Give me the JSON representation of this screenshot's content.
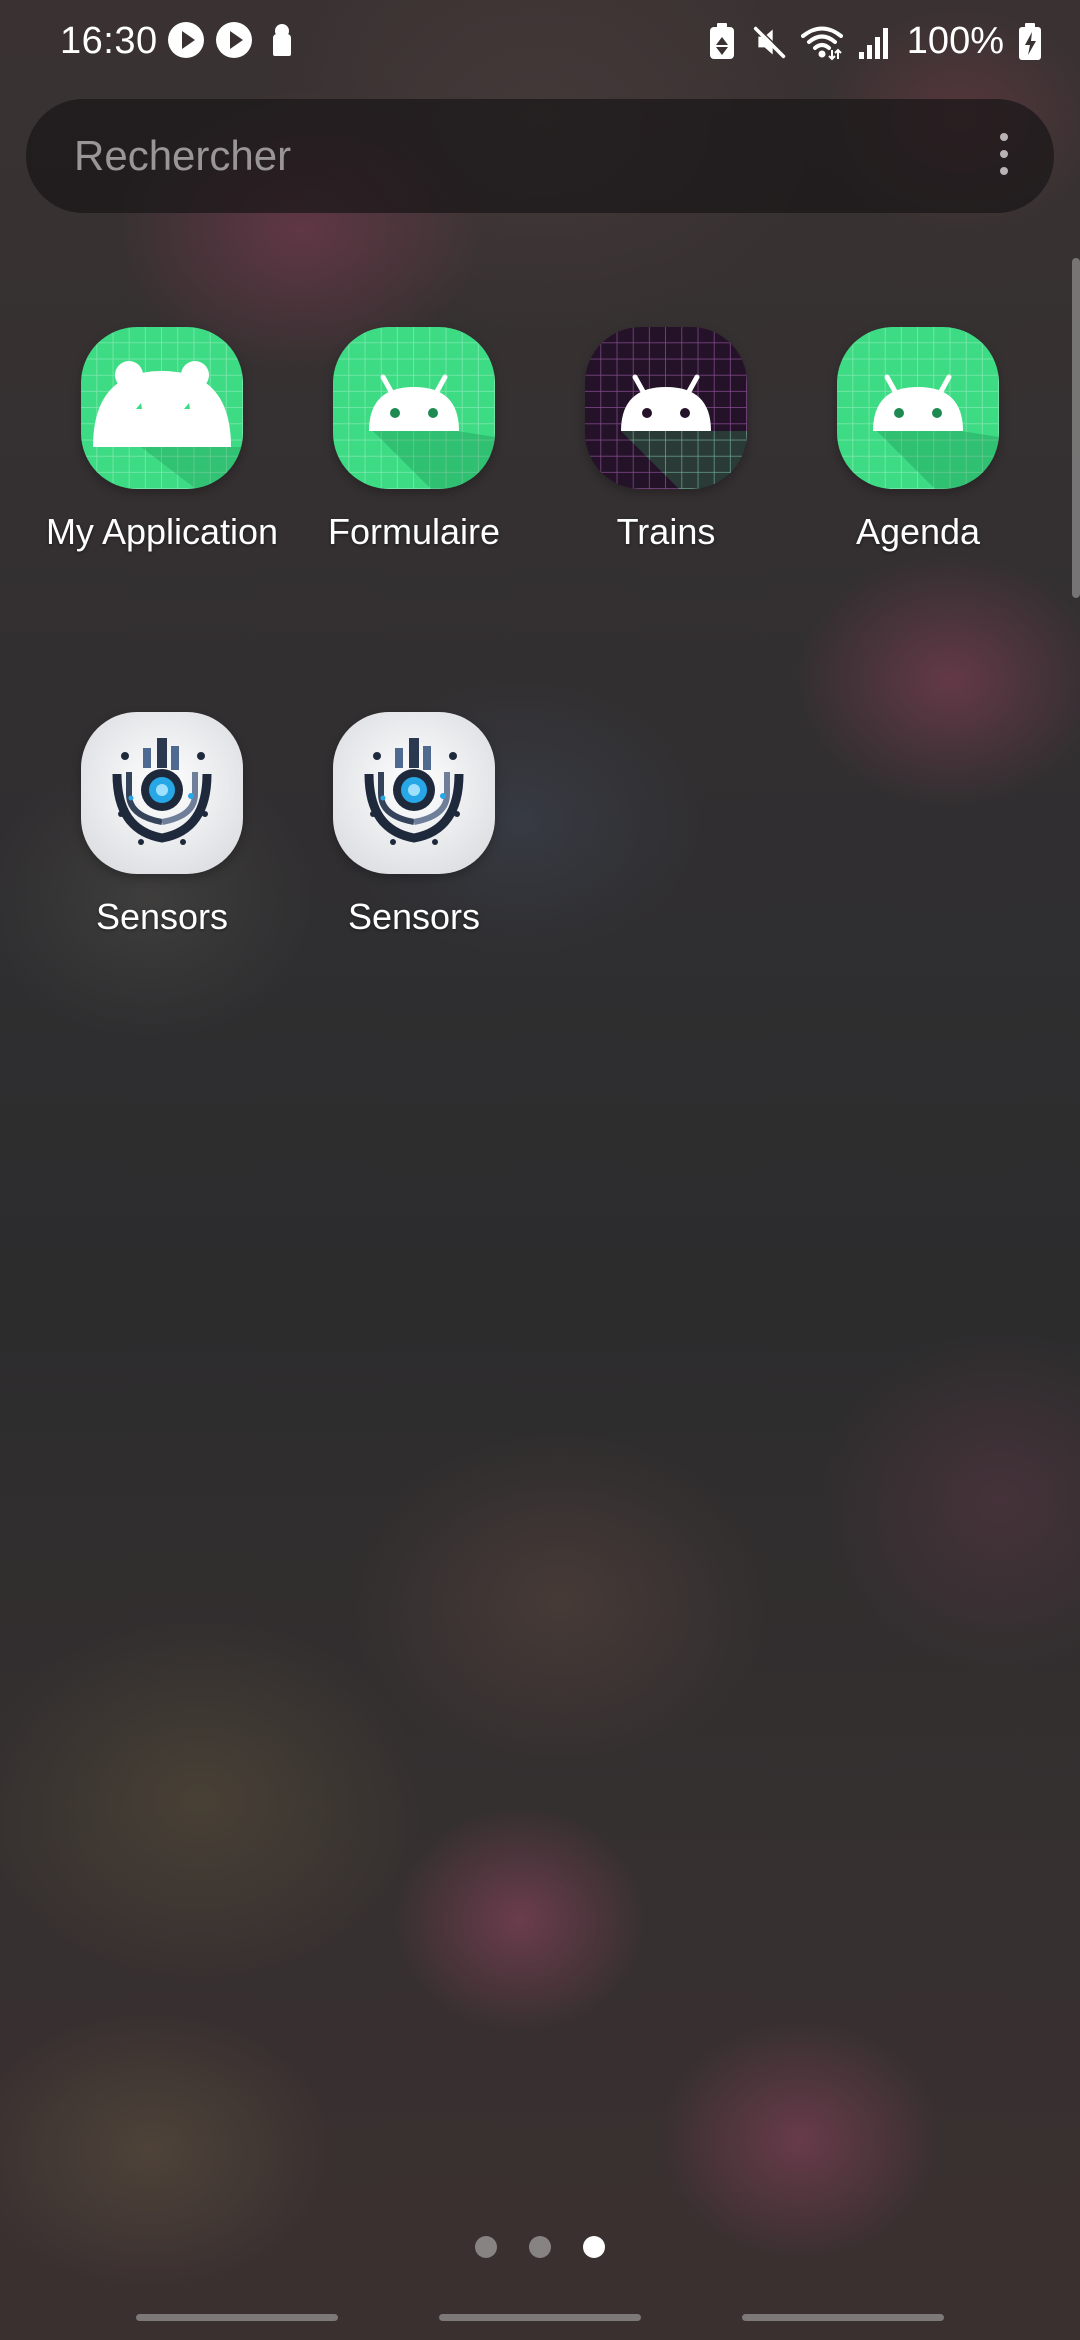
{
  "status_bar": {
    "time": "16:30",
    "battery": "100%",
    "left_icons": [
      "play-icon",
      "play-icon",
      "keyhole-icon"
    ],
    "right_icons": [
      "battery-saver-icon",
      "mute-icon",
      "wifi-icon",
      "signal-icon",
      "battery-charging-icon"
    ]
  },
  "search": {
    "placeholder": "Rechercher",
    "menu_icon": "more-vert-icon"
  },
  "apps": [
    {
      "label": "My Application",
      "icon": "bear-icon",
      "style": "green-grid"
    },
    {
      "label": "Formulaire",
      "icon": "android-icon",
      "style": "green-grid"
    },
    {
      "label": "Trains",
      "icon": "android-icon",
      "style": "purple-grid"
    },
    {
      "label": "Agenda",
      "icon": "android-icon",
      "style": "green-grid"
    },
    {
      "label": "Sensors",
      "icon": "sensor-chip-icon",
      "style": "tech"
    },
    {
      "label": "Sensors",
      "icon": "sensor-chip-icon",
      "style": "tech"
    }
  ],
  "page_indicator": {
    "pages": 3,
    "active_page": 3
  },
  "colors": {
    "green_icon": "#3ddc84",
    "purple_icon": "#241328",
    "search_bg": "#1b1718"
  }
}
